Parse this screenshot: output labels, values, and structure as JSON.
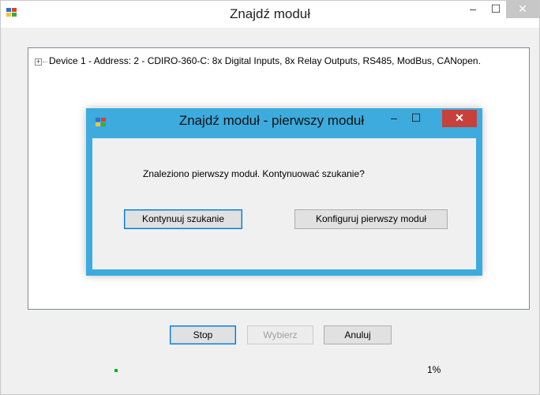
{
  "main_window": {
    "title": "Znajdź moduł",
    "min_glyph": "–",
    "max_glyph": "☐",
    "close_glyph": "✕"
  },
  "tree": {
    "expander_glyph": "+",
    "items": [
      {
        "label": "Device 1 - Address: 2 - CDIRO-360-C: 8x Digital Inputs, 8x Relay Outputs, RS485, ModBus, CANopen."
      }
    ]
  },
  "dialog": {
    "title": "Znajdź moduł - pierwszy moduł",
    "message": "Znaleziono pierwszy moduł. Kontynuować szukanie?",
    "continue_label": "Kontynuuj szukanie",
    "configure_label": "Konfiguruj pierwszy moduł",
    "min_glyph": "–",
    "max_glyph": "☐",
    "close_glyph": "✕"
  },
  "buttons": {
    "stop_label": "Stop",
    "select_label": "Wybierz",
    "cancel_label": "Anuluj"
  },
  "progress": {
    "value_fraction": 0.01,
    "label": "1%"
  },
  "colors": {
    "dialog_frame": "#3dabdd",
    "dialog_close": "#c7413a",
    "progress_fill": "#06b025",
    "icon_red": "#e0402b",
    "icon_blue": "#2f6fd1",
    "icon_yellow": "#f2c43d",
    "icon_green": "#3bab3c"
  }
}
